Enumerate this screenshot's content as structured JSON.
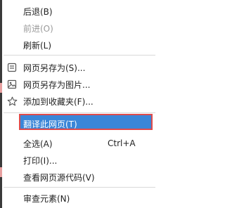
{
  "menu": {
    "items": [
      {
        "label": "后退(B)",
        "shortcut": "",
        "disabled": false,
        "icon": ""
      },
      {
        "label": "前进(O)",
        "shortcut": "",
        "disabled": true,
        "icon": ""
      },
      {
        "label": "刷新(L)",
        "shortcut": "",
        "disabled": false,
        "icon": ""
      },
      {
        "label": "网页另存为(S)...",
        "shortcut": "",
        "disabled": false,
        "icon": "save-page-icon"
      },
      {
        "label": "网页另存为图片...",
        "shortcut": "",
        "disabled": false,
        "icon": "save-image-icon"
      },
      {
        "label": "添加到收藏夹(F)...",
        "shortcut": "",
        "disabled": false,
        "icon": "star-icon"
      },
      {
        "label": "翻译此网页(T)",
        "shortcut": "",
        "disabled": false,
        "icon": "",
        "highlighted": true
      },
      {
        "label": "全选(A)",
        "shortcut": "Ctrl+A",
        "disabled": false,
        "icon": ""
      },
      {
        "label": "打印(I)...",
        "shortcut": "",
        "disabled": false,
        "icon": ""
      },
      {
        "label": "查看网页源代码(V)",
        "shortcut": "",
        "disabled": false,
        "icon": ""
      },
      {
        "label": "审查元素(N)",
        "shortcut": "",
        "disabled": false,
        "icon": ""
      }
    ]
  },
  "colors": {
    "highlight": "#3a86d8",
    "highlight_border": "#e04b4b",
    "disabled_text": "#9a9a9a"
  }
}
